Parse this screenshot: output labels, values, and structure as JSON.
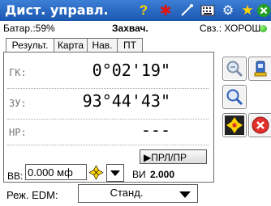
{
  "app": {
    "title": "Дист. управл."
  },
  "titlebar_icons": [
    "help-icon",
    "laser-icon",
    "satellite-icon",
    "keyboard-icon",
    "gear-icon",
    "star-icon",
    "close-icon"
  ],
  "status": {
    "battery": "Батар.:59%",
    "capture": "Захвач.",
    "connection": "Свз.: ХОРОШ."
  },
  "tabs": [
    {
      "label": "Результ.",
      "active": true
    },
    {
      "label": "Карта",
      "active": false
    },
    {
      "label": "Нав.",
      "active": false
    },
    {
      "label": "ПТ",
      "active": false
    }
  ],
  "measurements": [
    {
      "label": "ГК:",
      "value": "0°02'19\""
    },
    {
      "label": "ЗУ:",
      "value": "93°44'43\""
    },
    {
      "label": "НР:",
      "value": "---"
    }
  ],
  "controls": {
    "vv_label": "ВВ:",
    "vv_value": "0.000 мф",
    "prl_button": "▶ПРЛ/ПР",
    "vi_label": "ВИ",
    "vi_value": "2.000"
  },
  "bottom": {
    "mode_label": "Реж. EDM:",
    "mode_value": "Станд."
  },
  "colors": {
    "titlebar": "#1a56b0",
    "accent_green": "#1aa31a",
    "stop_red": "#e0312c"
  }
}
